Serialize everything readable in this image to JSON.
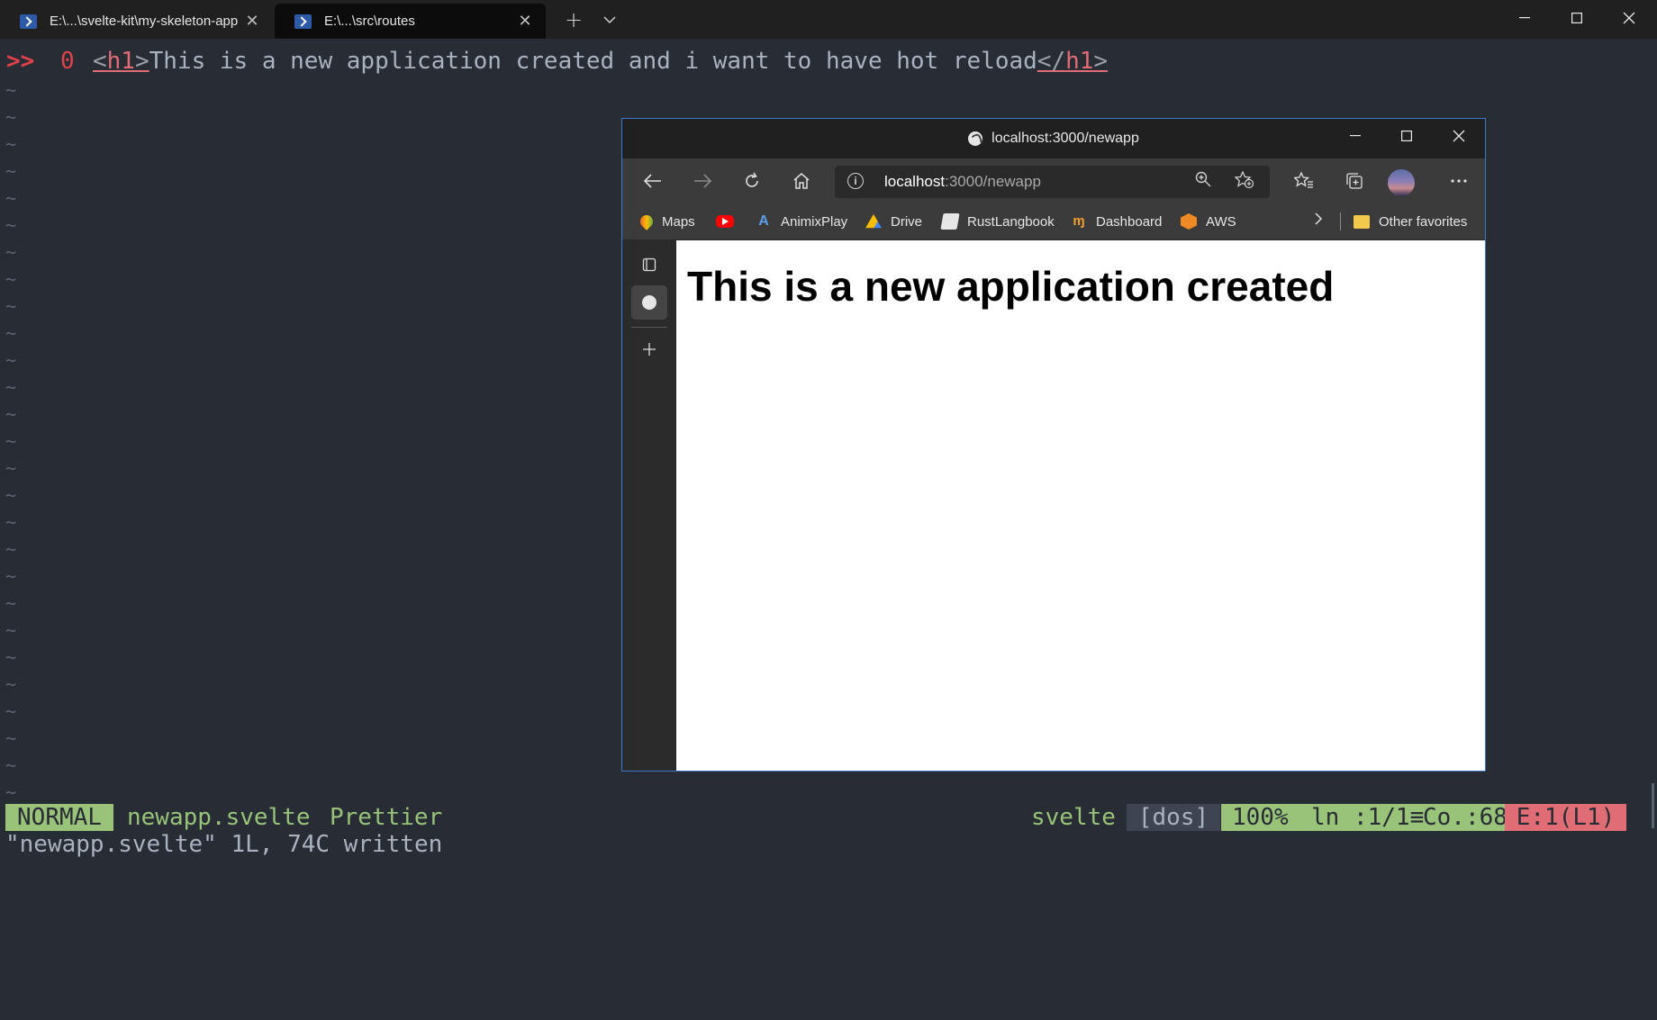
{
  "terminal": {
    "tabs": [
      {
        "label": "E:\\...\\svelte-kit\\my-skeleton-app",
        "active": false
      },
      {
        "label": "E:\\...\\src\\routes",
        "active": true
      }
    ],
    "new_tab": "+",
    "dropdown": "⌄",
    "window_controls": {
      "minimize": "─",
      "maximize": "☐",
      "close": "✕"
    }
  },
  "editor": {
    "sign": ">>",
    "line_number": "0",
    "line": {
      "open_bracket": "<",
      "open_tag": "h1",
      "close_angle": ">",
      "text": "This is a new application created and i want to have hot reload",
      "close_open": "</",
      "close_tag": "h1",
      "close_angle2": ">"
    },
    "tilde": "~",
    "tilde_count": 27
  },
  "statusline": {
    "mode": "NORMAL",
    "filename": "newapp.svelte",
    "formatter": "Prettier",
    "filetype": "svelte",
    "fileformat": "[dos]",
    "percent": "100%",
    "line_info": "ln :1/1≡",
    "col_info": "Co.:68",
    "error_info": "E:1(L1)"
  },
  "message": "\"newapp.svelte\" 1L, 74C written",
  "browser": {
    "title": "localhost:3000/newapp",
    "url_host": "localhost",
    "url_path": ":3000/newapp",
    "window_controls": {
      "minimize": "─",
      "maximize": "☐",
      "close": "✕"
    },
    "bookmarks": [
      {
        "label": "Maps",
        "icon": "maps-icon"
      },
      {
        "label": "",
        "icon": "youtube-icon"
      },
      {
        "label": "AnimixPlay",
        "icon": "animixplay-icon"
      },
      {
        "label": "Drive",
        "icon": "drive-icon"
      },
      {
        "label": "RustLangbook",
        "icon": "book-icon"
      },
      {
        "label": "Dashboard",
        "icon": "dashboard-icon"
      },
      {
        "label": "AWS",
        "icon": "aws-icon"
      }
    ],
    "other_favorites": "Other favorites",
    "page_heading": "This is a new application created"
  },
  "colors": {
    "editor_bg": "#282c34",
    "mode_bg": "#98c379",
    "error_bg": "#e06c75",
    "tag": "#e06c75",
    "browser_border": "#3a78c9"
  }
}
